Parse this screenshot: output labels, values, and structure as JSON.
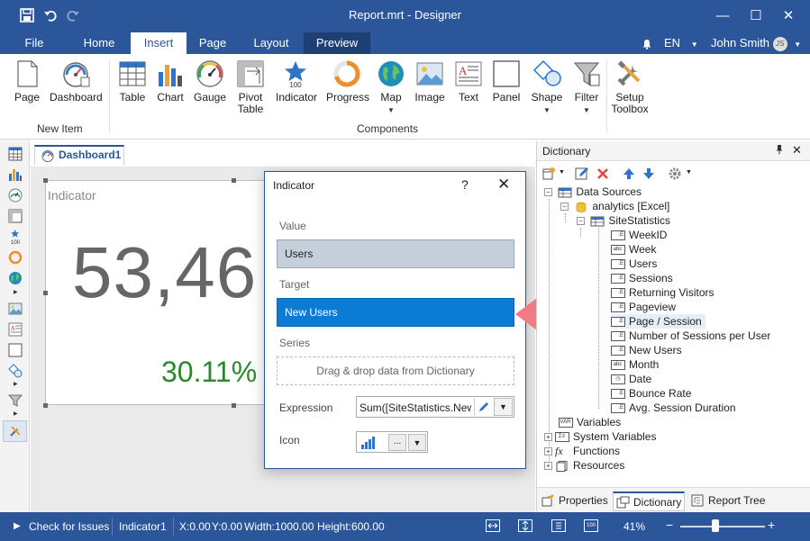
{
  "window": {
    "title": "Report.mrt - Designer",
    "minimize": "—",
    "maximize": "☐",
    "close": "✕"
  },
  "menu": {
    "tabs": [
      {
        "label": "File"
      },
      {
        "label": "Home"
      },
      {
        "label": "Insert"
      },
      {
        "label": "Page"
      },
      {
        "label": "Layout"
      },
      {
        "label": "Preview"
      }
    ],
    "active": "Insert",
    "language": "EN",
    "user": "John Smith",
    "user_initials": "JS"
  },
  "ribbon": {
    "new_item": {
      "label": "New Item",
      "buttons": [
        {
          "label": "Page"
        },
        {
          "label": "Dashboard"
        }
      ]
    },
    "components": {
      "label": "Components",
      "buttons": [
        {
          "label": "Table"
        },
        {
          "label": "Chart"
        },
        {
          "label": "Gauge"
        },
        {
          "label": "Pivot\nTable",
          "l1": "Pivot",
          "l2": "Table"
        },
        {
          "label": "Indicator"
        },
        {
          "label": "Progress"
        },
        {
          "label": "Map"
        },
        {
          "label": "Image"
        },
        {
          "label": "Text"
        },
        {
          "label": "Panel"
        },
        {
          "label": "Shape"
        },
        {
          "label": "Filter"
        },
        {
          "label": "Setup Toolbox",
          "l1": "Setup",
          "l2": "Toolbox"
        }
      ]
    },
    "indicator_icon_number": "100"
  },
  "document": {
    "tab_label": "Dashboard1"
  },
  "indicator_component": {
    "title": "Indicator",
    "value": "53,46",
    "percent": "30.11%"
  },
  "dialog": {
    "title": "Indicator",
    "help": "?",
    "close": "✕",
    "value_label": "Value",
    "value_field": "Users",
    "target_label": "Target",
    "target_field": "New Users",
    "series_label": "Series",
    "series_placeholder": "Drag & drop data from Dictionary",
    "expression_label": "Expression",
    "expression_value": "Sum([SiteStatistics.New U",
    "icon_label": "Icon",
    "icon_more": "...",
    "icon_name": "signal-bars-icon"
  },
  "dictionary": {
    "title": "Dictionary",
    "tree": {
      "data_sources": "Data Sources",
      "connection": "analytics [Excel]",
      "table": "SiteStatistics",
      "columns": [
        {
          "name": "WeekID",
          "type": "E"
        },
        {
          "name": "Week",
          "type": "abc"
        },
        {
          "name": "Users",
          "type": "E"
        },
        {
          "name": "Sessions",
          "type": "E"
        },
        {
          "name": "Returning Visitors",
          "type": "E"
        },
        {
          "name": "Pageview",
          "type": "E"
        },
        {
          "name": "Page / Session",
          "type": "E"
        },
        {
          "name": "Number of Sessions per User",
          "type": "E"
        },
        {
          "name": "New Users",
          "type": "E"
        },
        {
          "name": "Month",
          "type": "abc"
        },
        {
          "name": "Date",
          "type": "clock"
        },
        {
          "name": "Bounce Rate",
          "type": "E"
        },
        {
          "name": "Avg. Session Duration",
          "type": "E"
        }
      ],
      "variables": "Variables",
      "system_variables": "System Variables",
      "functions": "Functions",
      "resources": "Resources"
    },
    "bottom_tabs": [
      {
        "label": "Properties"
      },
      {
        "label": "Dictionary"
      },
      {
        "label": "Report Tree"
      }
    ]
  },
  "statusbar": {
    "check_issues": "Check for Issues",
    "component": "Indicator1",
    "x": "X:0.00",
    "y": "Y:0.00",
    "width": "Width:1000.00",
    "height": "Height:600.00",
    "zoom": "41%",
    "zoom_fit_icon_text": "100",
    "zoom_out": "−",
    "zoom_in": "+",
    "zoom_fraction": 0.41
  },
  "colors": {
    "accent": "#2b579a",
    "target_highlight": "#0c7bd4",
    "arrow": "#f07b84",
    "percent_green": "#2a8a2a"
  }
}
